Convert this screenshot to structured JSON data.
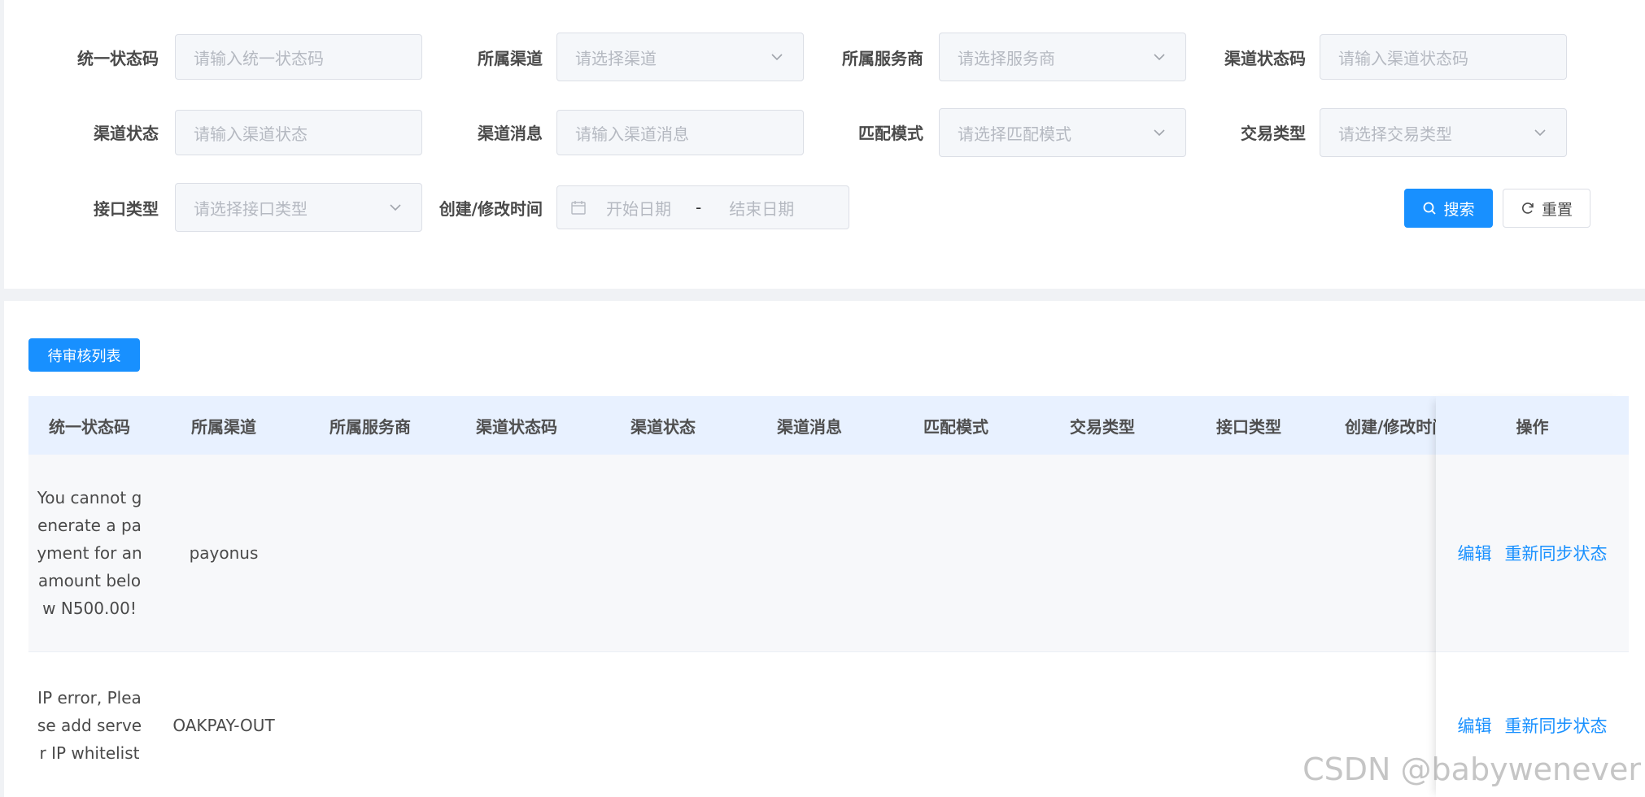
{
  "search": {
    "row1": [
      {
        "label": "统一状态码",
        "placeholder": "请输入统一状态码",
        "type": "input"
      },
      {
        "label": "所属渠道",
        "placeholder": "请选择渠道",
        "type": "select"
      },
      {
        "label": "所属服务商",
        "placeholder": "请选择服务商",
        "type": "select"
      },
      {
        "label": "渠道状态码",
        "placeholder": "请输入渠道状态码",
        "type": "input"
      }
    ],
    "row2": [
      {
        "label": "渠道状态",
        "placeholder": "请输入渠道状态",
        "type": "input"
      },
      {
        "label": "渠道消息",
        "placeholder": "请输入渠道消息",
        "type": "input"
      },
      {
        "label": "匹配模式",
        "placeholder": "请选择匹配模式",
        "type": "select"
      },
      {
        "label": "交易类型",
        "placeholder": "请选择交易类型",
        "type": "select"
      }
    ],
    "row3": [
      {
        "label": "接口类型",
        "placeholder": "请选择接口类型",
        "type": "select"
      },
      {
        "label": "创建/修改时间",
        "start_placeholder": "开始日期",
        "separator": "-",
        "end_placeholder": "结束日期",
        "type": "daterange"
      }
    ],
    "search_button": "搜索",
    "reset_button": "重置"
  },
  "table": {
    "pending_button": "待审核列表",
    "columns": [
      "统一状态码",
      "所属渠道",
      "所属服务商",
      "渠道状态码",
      "渠道状态",
      "渠道消息",
      "匹配模式",
      "交易类型",
      "接口类型",
      "创建/修改时间",
      "操作"
    ],
    "rows": [
      {
        "code": "You cannot generate a payment for an amount below N500.00!",
        "channel": "payonus",
        "edit": "编辑",
        "resync": "重新同步状态"
      },
      {
        "code": "IP error, Please add server IP whitelist",
        "channel": "OAKPAY-OUT",
        "edit": "编辑",
        "resync": "重新同步状态"
      }
    ]
  },
  "watermark": "CSDN @babywenever",
  "colors": {
    "primary": "#1890ff",
    "header_bg": "#e8f1ff",
    "page_bg": "#f0f2f5"
  }
}
